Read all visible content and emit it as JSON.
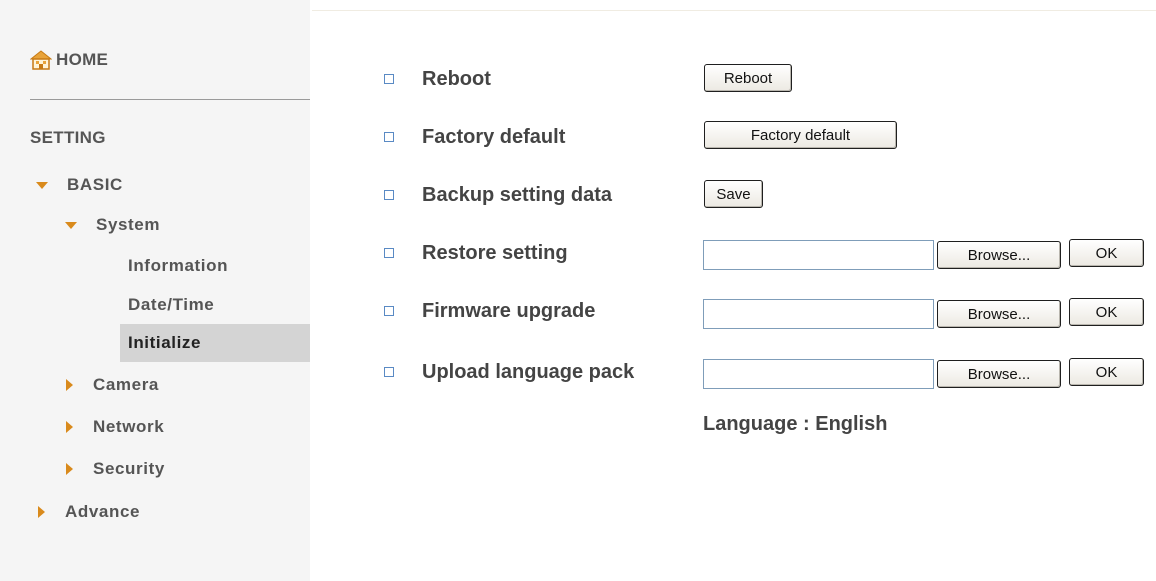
{
  "sidebar": {
    "home_label": "HOME",
    "section_label": "SETTING",
    "items": [
      {
        "label": "BASIC",
        "expanded": true
      },
      {
        "label": "System",
        "expanded": true
      },
      {
        "label": "Information"
      },
      {
        "label": "Date/Time"
      },
      {
        "label": "Initialize",
        "active": true
      },
      {
        "label": "Camera",
        "expanded": false
      },
      {
        "label": "Network",
        "expanded": false
      },
      {
        "label": "Security",
        "expanded": false
      },
      {
        "label": "Advance",
        "expanded": false
      }
    ]
  },
  "main": {
    "rows": [
      {
        "label": "Reboot",
        "button": "Reboot"
      },
      {
        "label": "Factory default",
        "button": "Factory default"
      },
      {
        "label": "Backup setting data",
        "button": "Save"
      },
      {
        "label": "Restore setting",
        "browse": "Browse...",
        "ok": "OK",
        "file_value": ""
      },
      {
        "label": "Firmware upgrade",
        "browse": "Browse...",
        "ok": "OK",
        "file_value": ""
      },
      {
        "label": "Upload language pack",
        "browse": "Browse...",
        "ok": "OK",
        "file_value": ""
      }
    ],
    "language_text": "Language : English"
  },
  "colors": {
    "accent_arrow": "#d98a1c",
    "bullet_border": "#5a8ac4",
    "active_bg": "#d4d4d4",
    "sidebar_bg": "#f5f5f5"
  },
  "icons": {
    "home": "home-icon",
    "expanded": "triangle-down-icon",
    "collapsed": "triangle-right-icon",
    "row_bullet": "square-bullet-icon"
  }
}
